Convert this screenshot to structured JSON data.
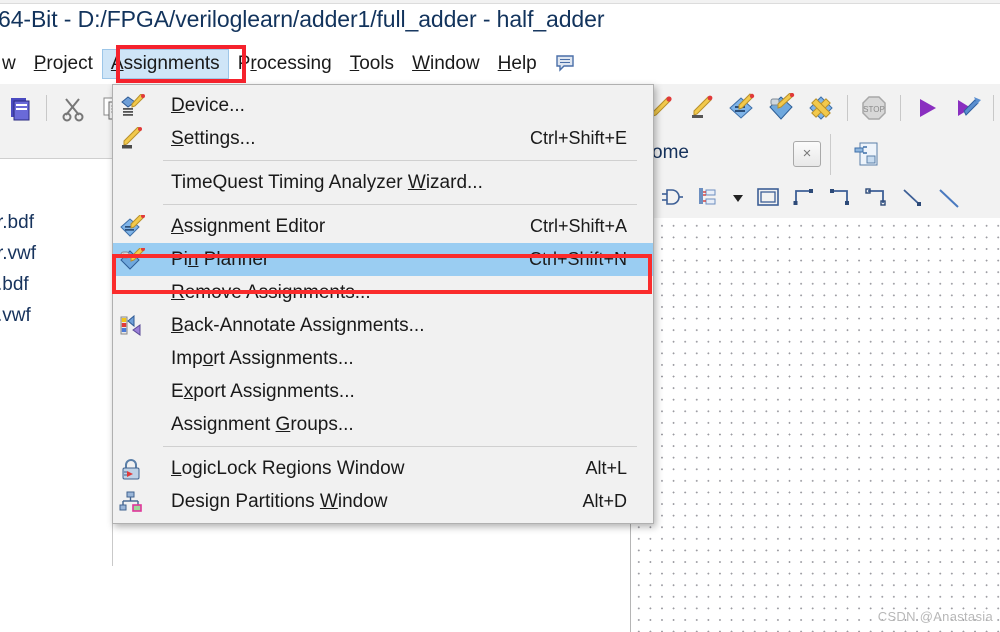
{
  "window": {
    "title": "64-Bit - D:/FPGA/veriloglearn/adder1/full_adder - half_adder"
  },
  "menubar": {
    "items": [
      {
        "label": "w",
        "mnemonic": "",
        "active": false,
        "name": "menu-view"
      },
      {
        "label": "Project",
        "mnemonic": "P",
        "active": false,
        "name": "menu-project"
      },
      {
        "label": "Assignments",
        "mnemonic": "A",
        "active": true,
        "name": "menu-assignments"
      },
      {
        "label": "Processing",
        "mnemonic": "r",
        "active": false,
        "name": "menu-processing"
      },
      {
        "label": "Tools",
        "mnemonic": "T",
        "active": false,
        "name": "menu-tools"
      },
      {
        "label": "Window",
        "mnemonic": "W",
        "active": false,
        "name": "menu-window"
      },
      {
        "label": "Help",
        "mnemonic": "H",
        "active": false,
        "name": "menu-help"
      }
    ],
    "hint_icon": "speech-balloon-icon"
  },
  "assignments_menu": {
    "items": [
      {
        "type": "item",
        "label": "Device...",
        "mnemonic": "D",
        "shortcut": "",
        "icon": "device-chip-pencil-icon",
        "selected": false
      },
      {
        "type": "item",
        "label": "Settings...",
        "mnemonic": "S",
        "shortcut": "Ctrl+Shift+E",
        "icon": "settings-pencil-icon",
        "selected": false
      },
      {
        "type": "separator"
      },
      {
        "type": "item",
        "label": "TimeQuest Timing Analyzer Wizard...",
        "mnemonic": "W",
        "shortcut": "",
        "icon": "",
        "selected": false
      },
      {
        "type": "separator"
      },
      {
        "type": "item",
        "label": "Assignment Editor",
        "mnemonic": "A",
        "shortcut": "Ctrl+Shift+A",
        "icon": "assignment-editor-icon",
        "selected": false
      },
      {
        "type": "item",
        "label": "Pin Planner",
        "mnemonic": "n",
        "shortcut": "Ctrl+Shift+N",
        "icon": "pin-planner-icon",
        "selected": true
      },
      {
        "type": "item",
        "label": "Remove Assignments...",
        "mnemonic": "R",
        "shortcut": "",
        "icon": "",
        "selected": false
      },
      {
        "type": "item",
        "label": "Back-Annotate Assignments...",
        "mnemonic": "B",
        "shortcut": "",
        "icon": "back-annotate-icon",
        "selected": false
      },
      {
        "type": "item",
        "label": "Import Assignments...",
        "mnemonic": "o",
        "shortcut": "",
        "icon": "",
        "selected": false
      },
      {
        "type": "item",
        "label": "Export Assignments...",
        "mnemonic": "x",
        "shortcut": "",
        "icon": "",
        "selected": false
      },
      {
        "type": "item",
        "label": "Assignment Groups...",
        "mnemonic": "G",
        "shortcut": "",
        "icon": "",
        "selected": false
      },
      {
        "type": "separator"
      },
      {
        "type": "item",
        "label": "LogicLock Regions Window",
        "mnemonic": "L",
        "shortcut": "Alt+L",
        "icon": "logiclock-padlock-icon",
        "selected": false
      },
      {
        "type": "item",
        "label": "Design Partitions Window",
        "mnemonic": "W",
        "shortcut": "Alt+D",
        "icon": "design-partitions-icon",
        "selected": false
      }
    ]
  },
  "toolbar": {
    "icons": [
      "open-project-icon",
      "separator",
      "cut-scissors-icon",
      "copy-pages-icon"
    ],
    "right_icons": [
      "pencil-small-icon",
      "pencil-stand-icon",
      "assignment-editor-icon",
      "pin-planner-icon",
      "compile-cross-icon",
      "separator",
      "stop-sign-icon",
      "separator",
      "start-play-icon",
      "start-compilation-icon",
      "separator"
    ]
  },
  "left_panel": {
    "files": [
      "r.bdf",
      "r.vwf",
      ".bdf",
      ".vwf"
    ]
  },
  "editor": {
    "tab_label": "ome",
    "close_label": "×",
    "doc_icon": "plug-document-icon",
    "draw_tools": [
      "logic-gate-icon",
      "symbol-block-icon",
      "chevron-down-icon",
      "rectangle-icon",
      "elbow-line-1-icon",
      "elbow-line-2-icon",
      "elbow-line-3-icon",
      "diagonal-line-icon",
      "diagonal-line-2-icon"
    ]
  },
  "watermark": {
    "text": "CSDN @Anastasia"
  },
  "colors": {
    "menu_bg": "#f1f1f1",
    "selection_blue": "#9acdf2",
    "highlight_red": "#fa2c2c",
    "menubar_active": "#cfe5f7",
    "title_text": "#12335c"
  }
}
